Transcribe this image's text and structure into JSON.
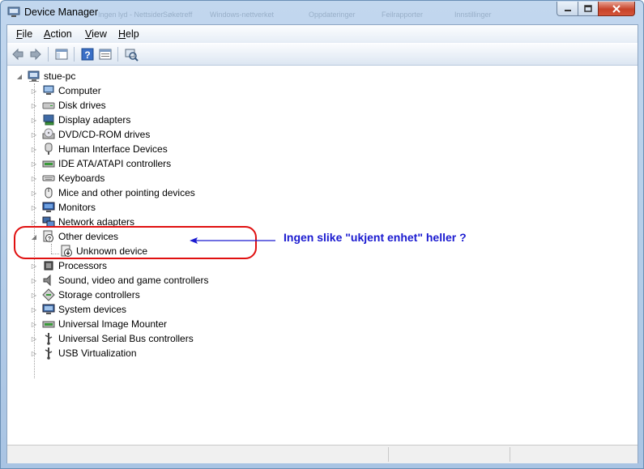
{
  "window": {
    "title": "Device Manager",
    "background_tab_labels": [
      "Ingen lyd - Nettsider",
      "Søketreff",
      "Windows-nettverket",
      "Oppdateringer",
      "Feilrapporter",
      "Innstillinger"
    ],
    "controls": {
      "minimize_icon": "minimize-icon",
      "maximize_icon": "maximize-icon",
      "close_icon": "close-icon"
    }
  },
  "menu": {
    "items": [
      {
        "label": "File"
      },
      {
        "label": "Action"
      },
      {
        "label": "View"
      },
      {
        "label": "Help"
      }
    ]
  },
  "toolbar": {
    "buttons": [
      "back-icon",
      "forward-icon",
      "show-hide-console-tree-icon",
      "help-icon",
      "properties-icon",
      "scan-hardware-icon"
    ]
  },
  "tree": {
    "root": {
      "label": "stue-pc",
      "expanded": true
    },
    "items": [
      {
        "label": "Computer",
        "icon": "computer-icon",
        "expanded": false
      },
      {
        "label": "Disk drives",
        "icon": "disk-drive-icon",
        "expanded": false
      },
      {
        "label": "Display adapters",
        "icon": "display-adapter-icon",
        "expanded": false
      },
      {
        "label": "DVD/CD-ROM drives",
        "icon": "dvd-drive-icon",
        "expanded": false
      },
      {
        "label": "Human Interface Devices",
        "icon": "hid-icon",
        "expanded": false
      },
      {
        "label": "IDE ATA/ATAPI controllers",
        "icon": "ide-controller-icon",
        "expanded": false
      },
      {
        "label": "Keyboards",
        "icon": "keyboard-icon",
        "expanded": false
      },
      {
        "label": "Mice and other pointing devices",
        "icon": "mouse-icon",
        "expanded": false
      },
      {
        "label": "Monitors",
        "icon": "monitor-icon",
        "expanded": false
      },
      {
        "label": "Network adapters",
        "icon": "network-adapter-icon",
        "expanded": false
      },
      {
        "label": "Other devices",
        "icon": "unknown-device-icon",
        "expanded": true,
        "children": [
          {
            "label": "Unknown device",
            "icon": "unknown-device-warning-icon"
          }
        ]
      },
      {
        "label": "Processors",
        "icon": "processor-icon",
        "expanded": false
      },
      {
        "label": "Sound, video and game controllers",
        "icon": "sound-icon",
        "expanded": false
      },
      {
        "label": "Storage controllers",
        "icon": "storage-controller-icon",
        "expanded": false
      },
      {
        "label": "System devices",
        "icon": "system-devices-icon",
        "expanded": false
      },
      {
        "label": "Universal Image Mounter",
        "icon": "image-mounter-icon",
        "expanded": false
      },
      {
        "label": "Universal Serial Bus controllers",
        "icon": "usb-icon",
        "expanded": false
      },
      {
        "label": "USB Virtualization",
        "icon": "usb-virtualization-icon",
        "expanded": false
      }
    ]
  },
  "annotation": {
    "text": "Ingen slike \"ukjent enhet\" heller ?",
    "color": "#1a1ad0",
    "highlight_color": "#e01010"
  },
  "colors": {
    "title_bar": "#b9d1ea",
    "close_button": "#c7432a",
    "tree_lines": "#a0a0a0"
  }
}
